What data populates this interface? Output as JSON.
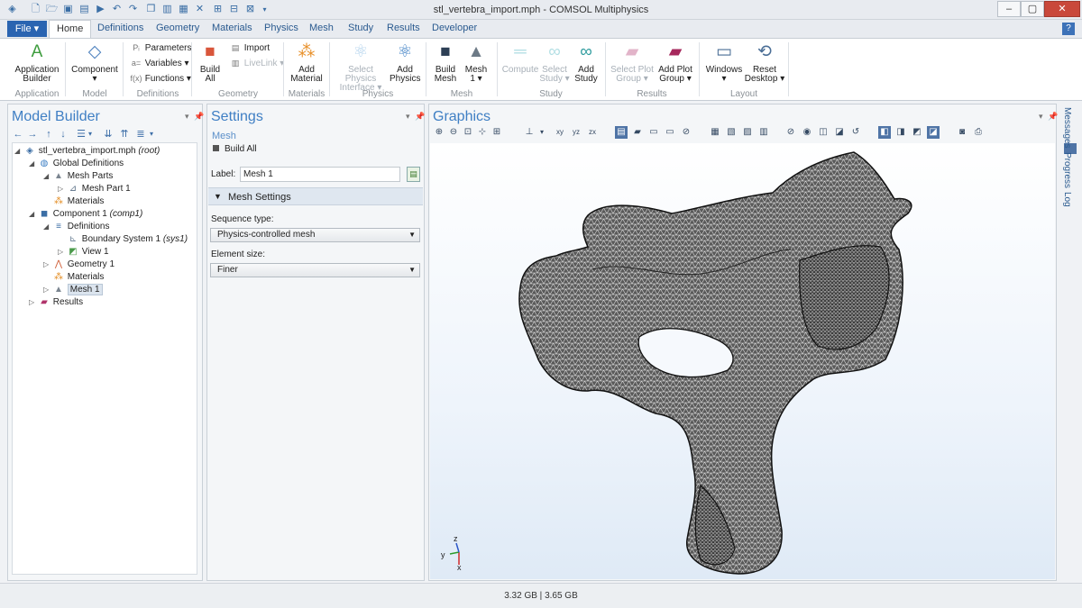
{
  "window": {
    "title": "stl_vertebra_import.mph - COMSOL Multiphysics"
  },
  "ribbon_tabs": [
    "File ▾",
    "Home",
    "Definitions",
    "Geometry",
    "Materials",
    "Physics",
    "Mesh",
    "Study",
    "Results",
    "Developer"
  ],
  "ribbon": {
    "app_builder": [
      "Application",
      "Builder"
    ],
    "component": [
      "Component",
      "▾"
    ],
    "parameters": "Parameters",
    "variables": "Variables ▾",
    "functions": "Functions ▾",
    "build_all": [
      "Build",
      "All"
    ],
    "import": "Import",
    "livelink": "LiveLink ▾",
    "add_material": [
      "Add",
      "Material"
    ],
    "select_physics": [
      "Select Physics",
      "Interface ▾"
    ],
    "add_physics": [
      "Add",
      "Physics"
    ],
    "build_mesh": [
      "Build",
      "Mesh"
    ],
    "mesh1": [
      "Mesh",
      "1 ▾"
    ],
    "compute": "Compute",
    "select_study": [
      "Select",
      "Study ▾"
    ],
    "add_study": [
      "Add",
      "Study"
    ],
    "select_plot_group": [
      "Select Plot",
      "Group ▾"
    ],
    "add_plot_group": [
      "Add Plot",
      "Group ▾"
    ],
    "windows": [
      "Windows",
      "▾"
    ],
    "reset_desktop": [
      "Reset",
      "Desktop ▾"
    ],
    "groups": [
      "Application",
      "Model",
      "Definitions",
      "Geometry",
      "Materials",
      "Physics",
      "Mesh",
      "Study",
      "Results",
      "Layout"
    ]
  },
  "model_builder": {
    "title": "Model Builder",
    "tree": [
      {
        "label": "stl_vertebra_import.mph",
        "tag": "(root)"
      },
      {
        "label": "Global Definitions",
        "tag": ""
      },
      {
        "label": "Mesh Parts",
        "tag": ""
      },
      {
        "label": "Mesh Part 1",
        "tag": ""
      },
      {
        "label": "Materials",
        "tag": ""
      },
      {
        "label": "Component 1",
        "tag": "(comp1)"
      },
      {
        "label": "Definitions",
        "tag": ""
      },
      {
        "label": "Boundary System 1",
        "tag": "(sys1)"
      },
      {
        "label": "View 1",
        "tag": ""
      },
      {
        "label": "Geometry 1",
        "tag": ""
      },
      {
        "label": "Materials",
        "tag": ""
      },
      {
        "label": "Mesh 1",
        "tag": ""
      },
      {
        "label": "Results",
        "tag": ""
      }
    ]
  },
  "settings": {
    "title": "Settings",
    "subtitle": "Mesh",
    "build_all": "Build All",
    "label_caption": "Label:",
    "label_value": "Mesh 1",
    "section": "Mesh Settings",
    "sequence_type_label": "Sequence type:",
    "sequence_type_value": "Physics-controlled mesh",
    "element_size_label": "Element size:",
    "element_size_value": "Finer"
  },
  "graphics": {
    "title": "Graphics",
    "axes": {
      "x": "x",
      "y": "y",
      "z": "z"
    }
  },
  "side_tabs": [
    "Messages",
    "Progress",
    "Log"
  ],
  "status": {
    "memory": "3.32 GB | 3.65 GB"
  }
}
